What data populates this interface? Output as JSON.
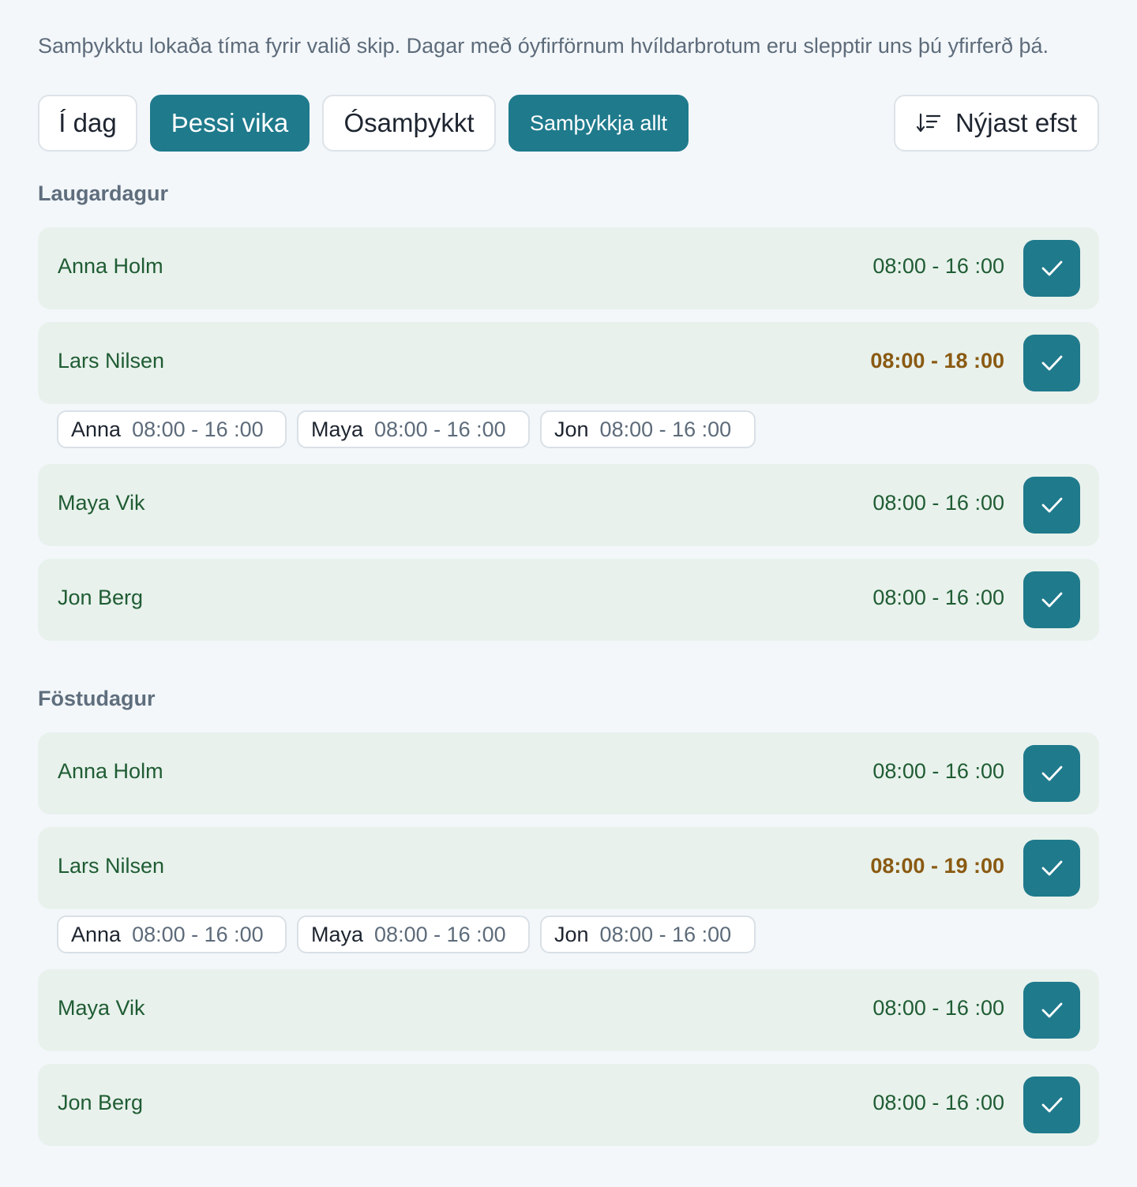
{
  "intro": "Samþykktu lokaða tíma fyrir valið skip. Dagar með óyfirförnum hvíldarbrotum eru slepptir uns þú yfirferð þá.",
  "toolbar": {
    "today": "Í dag",
    "this_week": "Þessi vika",
    "unapproved": "Ósamþykkt",
    "approve_all": "Samþykkja allt",
    "sort": "Nýjast efst"
  },
  "colors": {
    "accent": "#1f7a8c",
    "row_bg": "#e8f1ec",
    "name_text": "#1f5c33",
    "warning_text": "#8a5a12"
  },
  "days": [
    {
      "heading": "Laugardagur",
      "shifts": [
        {
          "name": "Anna Holm",
          "time": "08:00 -  16 :00",
          "warning": false
        },
        {
          "name": "Lars Nilsen",
          "time": "08:00 -  18 :00",
          "warning": true,
          "overlaps": [
            {
              "name": "Anna",
              "time": "08:00 -  16 :00"
            },
            {
              "name": "Maya",
              "time": "08:00 -  16 :00"
            },
            {
              "name": "Jon",
              "time": "08:00 -  16 :00"
            }
          ]
        },
        {
          "name": "Maya Vik",
          "time": "08:00 -  16 :00",
          "warning": false
        },
        {
          "name": "Jon Berg",
          "time": "08:00 -  16 :00",
          "warning": false
        }
      ]
    },
    {
      "heading": "Föstudagur",
      "shifts": [
        {
          "name": "Anna Holm",
          "time": "08:00 -  16 :00",
          "warning": false
        },
        {
          "name": "Lars Nilsen",
          "time": "08:00 -  19 :00",
          "warning": true,
          "overlaps": [
            {
              "name": "Anna",
              "time": "08:00 -  16 :00"
            },
            {
              "name": "Maya",
              "time": "08:00 -  16 :00"
            },
            {
              "name": "Jon",
              "time": "08:00 -  16 :00"
            }
          ]
        },
        {
          "name": "Maya Vik",
          "time": "08:00 -  16 :00",
          "warning": false
        },
        {
          "name": "Jon Berg",
          "time": "08:00 -  16 :00",
          "warning": false
        }
      ]
    }
  ],
  "icons": {
    "approve": "check-icon",
    "sort": "sort-descending-icon"
  }
}
